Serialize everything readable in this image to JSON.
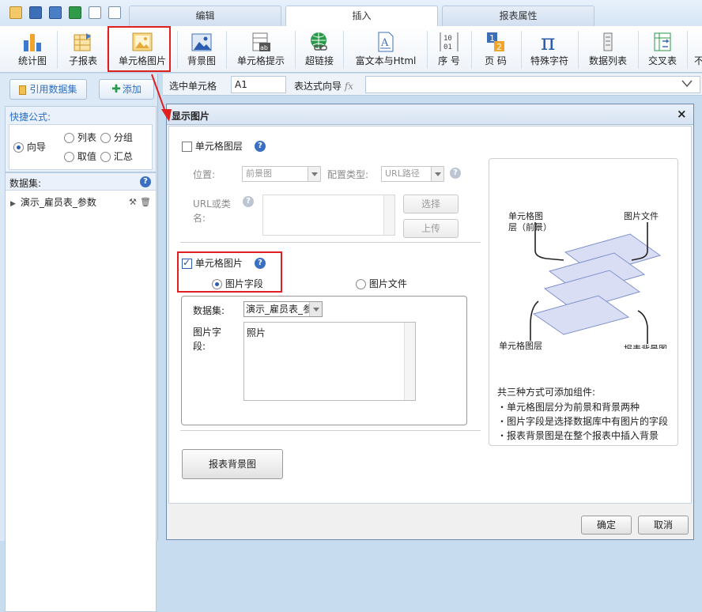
{
  "colors": {
    "accent": "#2a6fc9",
    "highlight": "#e02020",
    "ribbon_bg": "#ffffff",
    "panel_bg": "#dbe8f6"
  },
  "tabs": [
    {
      "label": "编辑",
      "active": false
    },
    {
      "label": "插入",
      "active": true
    },
    {
      "label": "报表属性",
      "active": false
    }
  ],
  "quick_access": [
    {
      "icon": "open-folder-icon"
    },
    {
      "icon": "save-icon"
    },
    {
      "icon": "save-as-icon"
    },
    {
      "icon": "excel-export-icon"
    },
    {
      "icon": "preview-icon"
    },
    {
      "icon": "zoom-icon"
    }
  ],
  "ribbon": [
    {
      "label": "统计图",
      "icon": "bar-chart-icon"
    },
    {
      "label": "子报表",
      "icon": "subreport-icon"
    },
    {
      "label": "单元格图片",
      "icon": "image-icon"
    },
    {
      "label": "背景图",
      "icon": "background-image-icon"
    },
    {
      "label": "单元格提示",
      "icon": "cell-tip-icon"
    },
    {
      "label": "超链接",
      "icon": "hyperlink-icon"
    },
    {
      "label": "富文本与Html",
      "icon": "rich-text-icon"
    },
    {
      "label": "序 号",
      "icon": "sequence-icon",
      "icon_text": "10\n01"
    },
    {
      "label": "页 码",
      "icon": "page-number-icon",
      "icon_text": "1 2"
    },
    {
      "label": "特殊字符",
      "icon": "special-char-icon",
      "icon_text": "π"
    },
    {
      "label": "数据列表",
      "icon": "data-list-icon"
    },
    {
      "label": "交叉表",
      "icon": "crosstab-icon"
    },
    {
      "label": "不",
      "icon": "more-icon"
    }
  ],
  "left_panel": {
    "btn_dataset": "引用数据集",
    "btn_add": "添加",
    "quick_formula_title": "快捷公式:",
    "radio_guide": "向导",
    "radio_list": "列表",
    "radio_group": "分组",
    "radio_value": "取值",
    "radio_summary": "汇总",
    "dataset_title": "数据集:",
    "dataset_item": "演示_雇员表_参数"
  },
  "formula_bar": {
    "label_selected": "选中单元格",
    "cell_ref": "A1",
    "label_expr": "表达式向导",
    "fx": "fx",
    "expr_value": ""
  },
  "dialog": {
    "title": "显示图片",
    "close": "×",
    "cell_layer_label": "单元格图层",
    "cell_layer_checked": false,
    "position_label": "位置:",
    "position_value": "前景图",
    "config_type_label": "配置类型:",
    "config_type_value": "URL路径",
    "url_label_1": "URL或类",
    "url_label_2": "名:",
    "select_btn": "选择",
    "upload_btn": "上传",
    "cell_image_label": "单元格图片",
    "cell_image_checked": true,
    "radio_image_field": "图片字段",
    "radio_image_file": "图片文件",
    "dataset_label": "数据集:",
    "dataset_value": "演示_雇员表_参",
    "image_field_label_1": "图片字",
    "image_field_label_2": "段:",
    "image_field_value": "照片",
    "report_bg_btn": "报表背景图",
    "ok_btn": "确定",
    "cancel_btn": "取消"
  },
  "diagram": {
    "label_cell_layer_front_1": "单元格图",
    "label_cell_layer_front_2": "层（前景）",
    "label_image_file": "图片文件",
    "label_cell_layer_back": "单元格图层",
    "label_bg_image": "报表背景图",
    "desc_title": "共三种方式可添加组件:",
    "desc_1": "・单元格图层分为前景和背景两种",
    "desc_2": "・图片字段是选择数据库中有图片的字段",
    "desc_3": "・报表背景图是在整个报表中插入背景"
  }
}
